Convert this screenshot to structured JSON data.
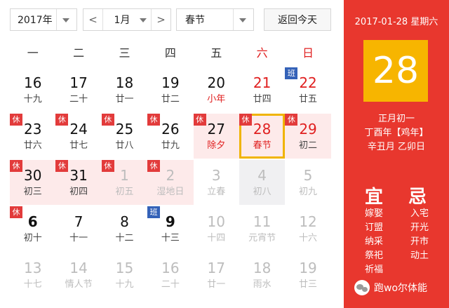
{
  "toolbar": {
    "year": "2017年",
    "prev_arrow": "<",
    "month": "1月",
    "next_arrow": ">",
    "holiday": "春节",
    "today_label": "返回今天"
  },
  "weekdays": [
    "一",
    "二",
    "三",
    "四",
    "五",
    "六",
    "日"
  ],
  "badge_labels": {
    "rest": "休",
    "work": "班"
  },
  "weeks": [
    [
      {
        "day": "16",
        "lunar": "十九"
      },
      {
        "day": "17",
        "lunar": "二十"
      },
      {
        "day": "18",
        "lunar": "廿一"
      },
      {
        "day": "19",
        "lunar": "廿二"
      },
      {
        "day": "20",
        "lunar": "小年",
        "festival": true
      },
      {
        "day": "21",
        "lunar": "廿四",
        "weekend": true
      },
      {
        "day": "22",
        "lunar": "廿五",
        "weekend": true,
        "badge": "work"
      }
    ],
    [
      {
        "day": "23",
        "lunar": "廿六",
        "badge": "rest"
      },
      {
        "day": "24",
        "lunar": "廿七",
        "badge": "rest"
      },
      {
        "day": "25",
        "lunar": "廿八",
        "badge": "rest"
      },
      {
        "day": "26",
        "lunar": "廿九",
        "badge": "rest"
      },
      {
        "day": "27",
        "lunar": "除夕",
        "festival": true,
        "badge": "rest",
        "bg": "rest"
      },
      {
        "day": "28",
        "lunar": "春节",
        "festival": true,
        "weekend": true,
        "badge": "rest",
        "bg": "rest",
        "selected": true
      },
      {
        "day": "29",
        "lunar": "初二",
        "weekend": true,
        "badge": "rest",
        "bg": "rest"
      }
    ],
    [
      {
        "day": "30",
        "lunar": "初三",
        "badge": "rest",
        "bg": "rest"
      },
      {
        "day": "31",
        "lunar": "初四",
        "badge": "rest",
        "bg": "rest"
      },
      {
        "day": "1",
        "lunar": "初五",
        "badge": "rest",
        "bg": "rest",
        "other": true
      },
      {
        "day": "2",
        "lunar": "湿地日",
        "badge": "rest",
        "bg": "rest",
        "other": true
      },
      {
        "day": "3",
        "lunar": "立春",
        "other": true
      },
      {
        "day": "4",
        "lunar": "初八",
        "other": true,
        "bg": "work"
      },
      {
        "day": "5",
        "lunar": "初九",
        "other": true
      }
    ],
    [
      {
        "day": "6",
        "lunar": "初十",
        "badge": "rest",
        "bold": true
      },
      {
        "day": "7",
        "lunar": "十一"
      },
      {
        "day": "8",
        "lunar": "十二"
      },
      {
        "day": "9",
        "lunar": "十三",
        "badge": "work",
        "bold": true
      },
      {
        "day": "10",
        "lunar": "十四",
        "other": true
      },
      {
        "day": "11",
        "lunar": "元宵节",
        "other": true
      },
      {
        "day": "12",
        "lunar": "十六",
        "other": true
      }
    ],
    [
      {
        "day": "13",
        "lunar": "十七",
        "other": true
      },
      {
        "day": "14",
        "lunar": "情人节",
        "other": true
      },
      {
        "day": "15",
        "lunar": "十九",
        "other": true
      },
      {
        "day": "16",
        "lunar": "二十",
        "other": true
      },
      {
        "day": "17",
        "lunar": "廿一",
        "other": true
      },
      {
        "day": "18",
        "lunar": "雨水",
        "other": true
      },
      {
        "day": "19",
        "lunar": "廿三",
        "other": true
      }
    ]
  ],
  "panel": {
    "date_line": "2017-01-28 星期六",
    "big_day": "28",
    "lunar_lines": [
      "正月初一",
      "丁酉年【鸡年】",
      "辛丑月 乙卯日"
    ],
    "yi_title": "宜",
    "ji_title": "忌",
    "yi": [
      "嫁娶",
      "订盟",
      "纳采",
      "祭祀",
      "祈福"
    ],
    "ji": [
      "入宅",
      "开光",
      "开市",
      "动土"
    ]
  },
  "watermark": {
    "text": "跑wo尔体能"
  },
  "colors": {
    "panel_bg": "#e8372e",
    "big_day_bg": "#f7b500",
    "rest_badge": "#e23b3b",
    "work_badge": "#3462b8",
    "selected_border": "#f0b400",
    "holiday_text": "#e02020"
  }
}
